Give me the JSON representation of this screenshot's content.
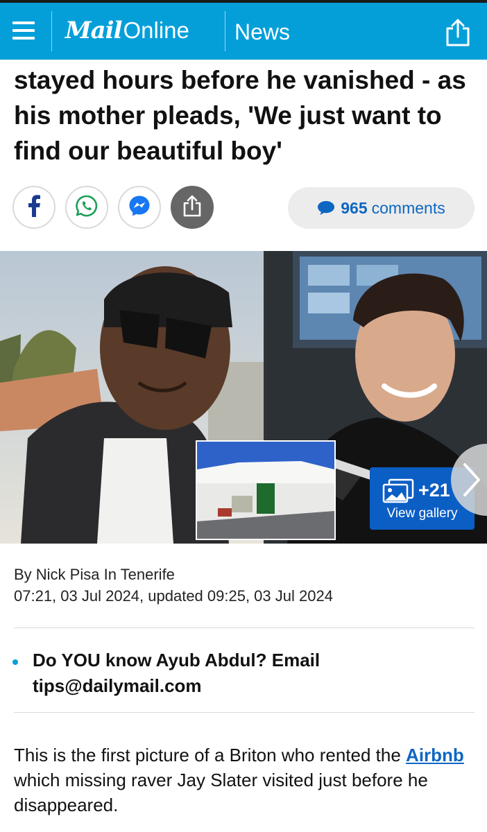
{
  "header": {
    "logo_mail": "Mail",
    "logo_online": "Online",
    "section": "News"
  },
  "article": {
    "headline_visible": "stayed hours before he vanished - as his mother pleads, 'We just want to find our beautiful boy'",
    "comments_count": "965",
    "comments_label": "comments",
    "gallery_count": "+21",
    "gallery_label": "View gallery",
    "byline": "By Nick Pisa In Tenerife",
    "timestamp": "07:21, 03 Jul 2024, updated 09:25, 03 Jul 2024",
    "highlight_bullet": "Do YOU know Ayub Abdul? Email tips@dailymail.com",
    "body_before_link": "This is the first picture of a Briton who rented the ",
    "body_link": "Airbnb",
    "body_after_link": " which missing raver Jay Slater visited just before he disappeared."
  },
  "share_buttons": [
    "facebook-icon",
    "whatsapp-icon",
    "messenger-icon",
    "share-icon"
  ],
  "colors": {
    "header_bg": "#049fd9",
    "link_blue": "#0c66c2",
    "gallery_bg": "#0b5ec4"
  }
}
